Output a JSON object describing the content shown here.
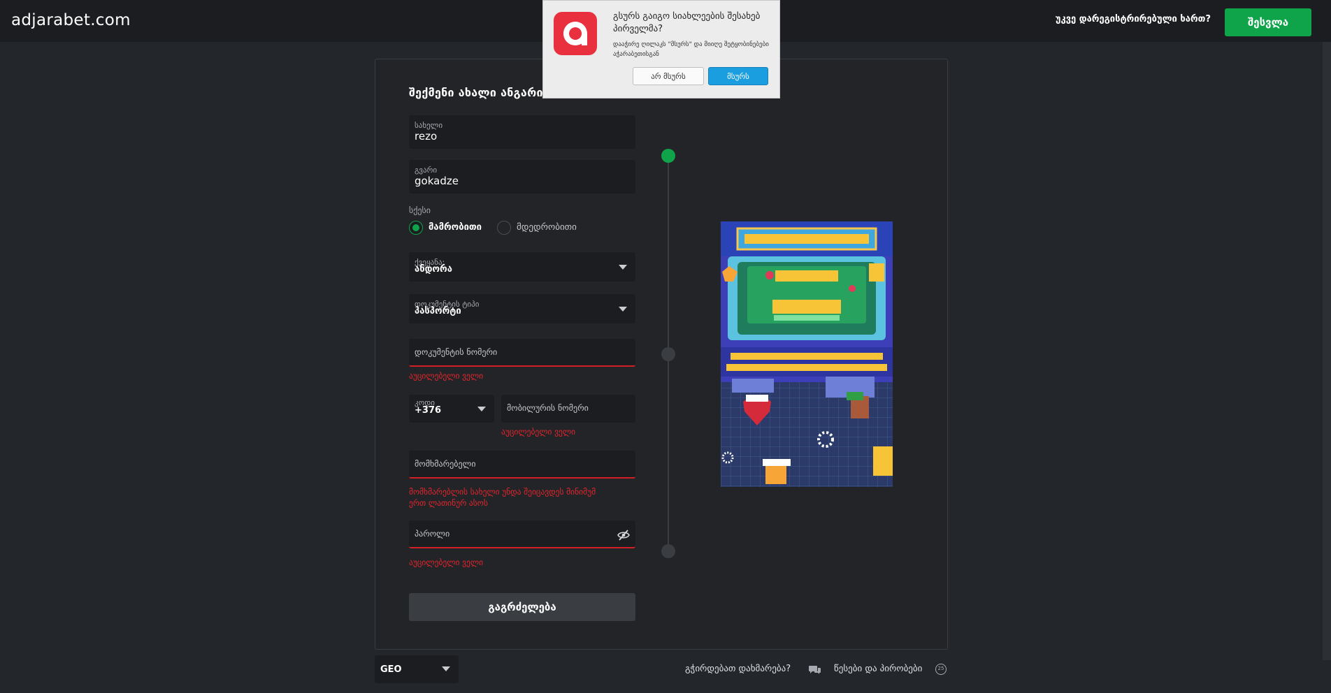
{
  "header": {
    "logo": "adjarabet.com",
    "already_registered": "უკვე დარეგისტრირებული ხართ?",
    "login_label": "შესვლა"
  },
  "form": {
    "title": "შექმენი ახალი ანგარიში",
    "first_name": {
      "label": "სახელი",
      "value": "rezo"
    },
    "last_name": {
      "label": "გვარი",
      "value": "gokadze"
    },
    "gender": {
      "label": "სქესი",
      "male": "მამრობითი",
      "female": "მდედრობითი",
      "selected": "male"
    },
    "country": {
      "label": "ქვეყანა:",
      "value": "ანდორა"
    },
    "doc_type": {
      "label": "დოკუმენტის ტიპი",
      "value": "პასპორტი"
    },
    "doc_number": {
      "placeholder": "დოკუმენტის ნომერი",
      "error": "აუცილებელი ველი"
    },
    "phone_code": {
      "label": "კოდი",
      "value": "+376"
    },
    "mobile": {
      "placeholder": "მობილურის ნომერი",
      "error": "აუცილებელი ველი"
    },
    "username": {
      "placeholder": "მომხმარებელი",
      "error_line1": "მომხმარებლის სახელი უნდა შეიცავდეს მინიმუმ",
      "error_line2": "ერთ ლათინურ ასოს"
    },
    "password": {
      "placeholder": "პაროლი",
      "error": "აუცილებელი ველი"
    },
    "continue_label": "გაგრძელება"
  },
  "stepper": {
    "steps": 3,
    "active": 1
  },
  "footer": {
    "language": "GEO",
    "help": "გჭირდებათ დახმარება?",
    "rules": "წესები და პირობები",
    "rules_badge": "25"
  },
  "notification": {
    "title": "გსურს გაიგო სიახლეების შესახებ პირველმა?",
    "body": "დააჭირე ღილაკს \"მსურს\" და მიიღე შეტყობინებები აჭარაბეთისგან",
    "no_label": "არ მსურს",
    "yes_label": "მსურს"
  },
  "colors": {
    "accent": "#0fa34a",
    "error": "#d31f26",
    "background": "#23262b"
  }
}
